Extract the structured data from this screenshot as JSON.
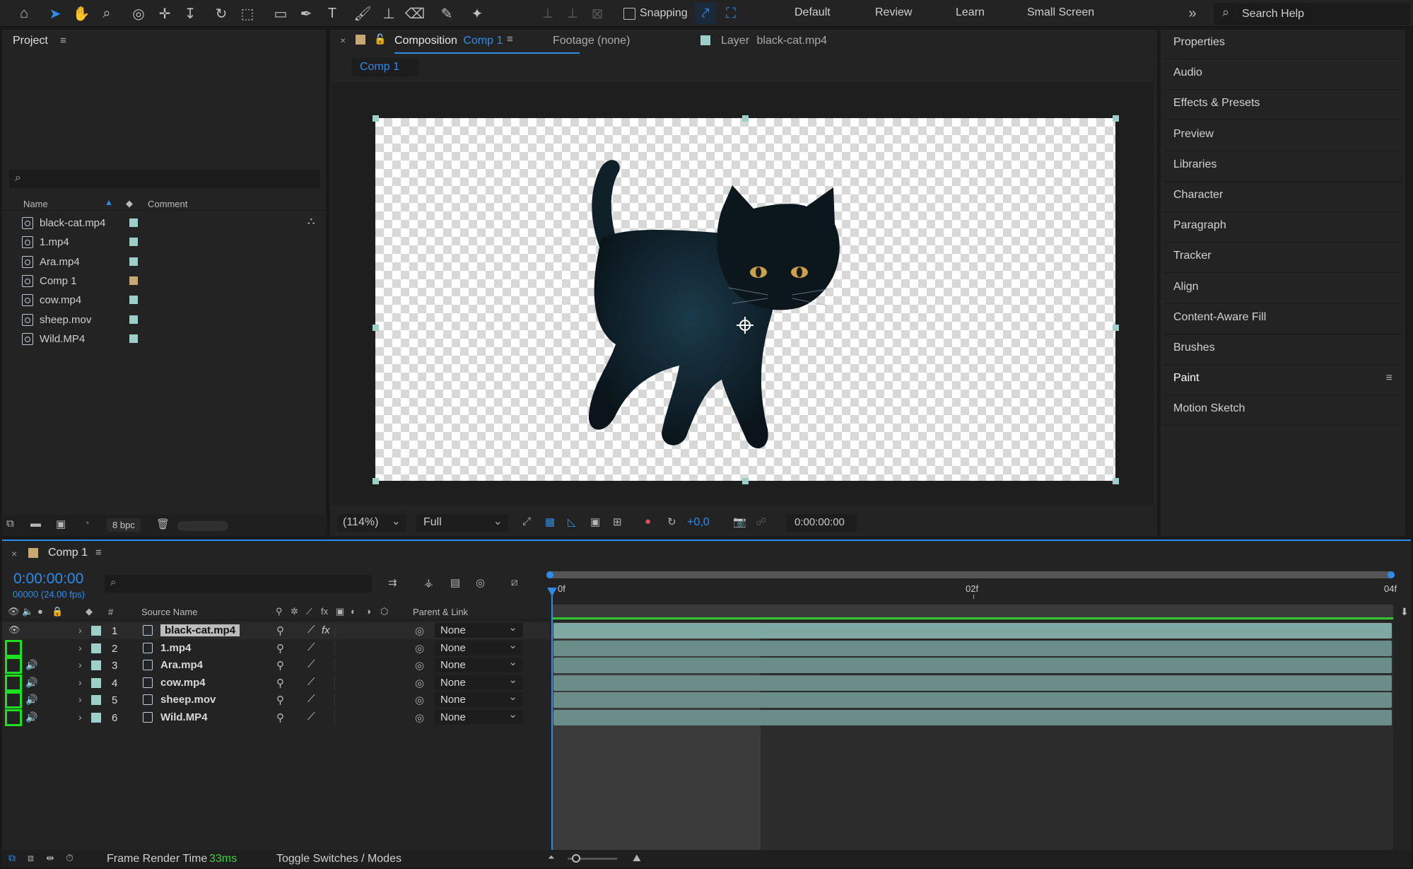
{
  "workspaces": [
    "Default",
    "Review",
    "Learn",
    "Small Screen"
  ],
  "toolbar": {
    "snapping": "Snapping",
    "search_placeholder": "Search Help"
  },
  "project": {
    "title": "Project",
    "columns": {
      "name": "Name",
      "comment": "Comment"
    },
    "items": [
      {
        "name": "black-cat.mp4",
        "label": "#9ccfc8",
        "type": "footage"
      },
      {
        "name": "1.mp4",
        "label": "#9ccfc8",
        "type": "footage"
      },
      {
        "name": "Ara.mp4",
        "label": "#9ccfc8",
        "type": "footage"
      },
      {
        "name": "Comp 1",
        "label": "#c8a872",
        "type": "comp"
      },
      {
        "name": "cow.mp4",
        "label": "#9ccfc8",
        "type": "footage"
      },
      {
        "name": "sheep.mov",
        "label": "#9ccfc8",
        "type": "footage"
      },
      {
        "name": "Wild.MP4",
        "label": "#9ccfc8",
        "type": "footage"
      }
    ],
    "bpc": "8 bpc"
  },
  "viewer": {
    "tab_composition": "Composition",
    "tab_comp_name": "Comp 1",
    "tab_footage": "Footage (none)",
    "tab_layer": "Layer",
    "tab_layer_name": "black-cat.mp4",
    "comp_chip": "Comp 1",
    "zoom": "(114%)",
    "resolution": "Full",
    "exposure": "+0,0",
    "timecode": "0:00:00:00"
  },
  "right_panels": [
    "Properties",
    "Audio",
    "Effects & Presets",
    "Preview",
    "Libraries",
    "Character",
    "Paragraph",
    "Tracker",
    "Align",
    "Content-Aware Fill",
    "Brushes",
    "Paint",
    "Motion Sketch"
  ],
  "timeline": {
    "comp_tab": "Comp 1",
    "timecode": "0:00:00:00",
    "frame_info": "00000 (24.00 fps)",
    "col_hash": "#",
    "col_source": "Source Name",
    "col_parent": "Parent & Link",
    "ruler": [
      "0f",
      "02f",
      "04f"
    ],
    "layers": [
      {
        "num": "1",
        "name": "black-cat.mp4",
        "parent": "None",
        "fx": "fx"
      },
      {
        "num": "2",
        "name": "1.mp4",
        "parent": "None"
      },
      {
        "num": "3",
        "name": "Ara.mp4",
        "parent": "None"
      },
      {
        "num": "4",
        "name": "cow.mp4",
        "parent": "None"
      },
      {
        "num": "5",
        "name": "sheep.mov",
        "parent": "None"
      },
      {
        "num": "6",
        "name": "Wild.MP4",
        "parent": "None"
      }
    ],
    "render_label": "Frame Render Time",
    "render_value": "33ms",
    "toggle": "Toggle Switches / Modes"
  },
  "colors": {
    "accent": "#2d8ceb",
    "highlight_green": "#1ee01e"
  }
}
